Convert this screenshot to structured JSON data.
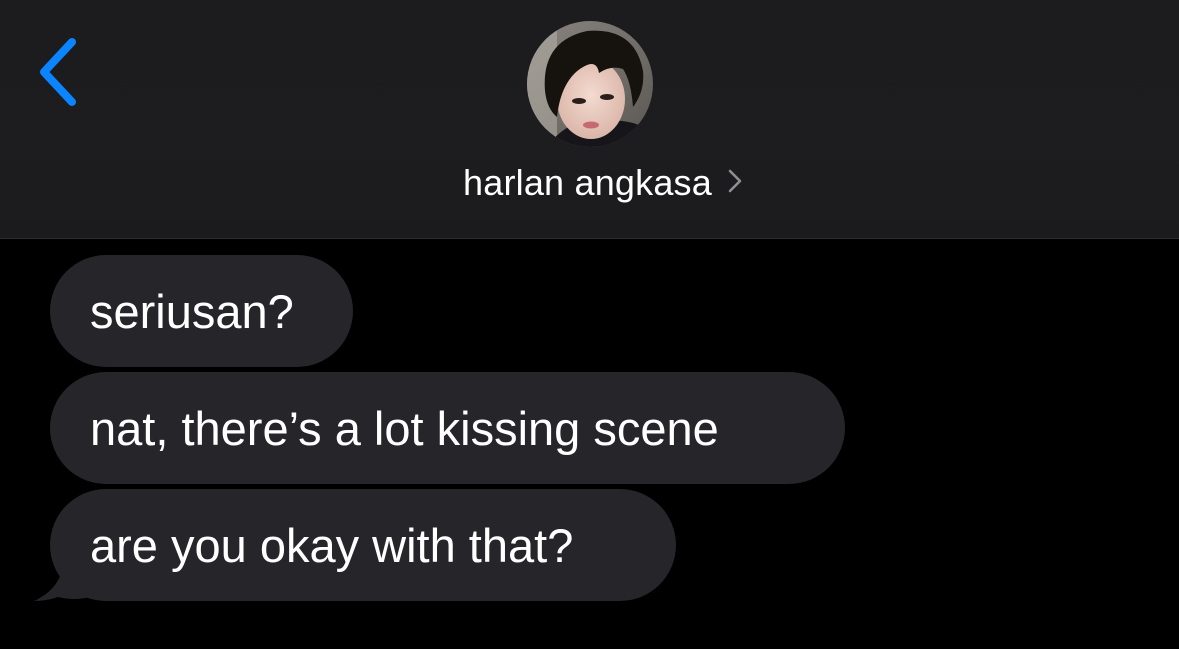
{
  "header": {
    "contact_name": "harlan angkasa",
    "back_icon": "chevron-left-icon",
    "detail_icon": "chevron-right-icon",
    "avatar_alt": "contact photo"
  },
  "messages": [
    {
      "direction": "incoming",
      "text": "seriusan?"
    },
    {
      "direction": "incoming",
      "text": "nat, there’s a lot kissing scene"
    },
    {
      "direction": "incoming",
      "text": "are you okay with that?"
    }
  ],
  "colors": {
    "accent": "#0a84ff",
    "header_bg": "#1c1c1e",
    "background": "#000000",
    "incoming_bubble": "#26252a",
    "text": "#ffffff",
    "chevron_gray": "#8e8e93"
  }
}
